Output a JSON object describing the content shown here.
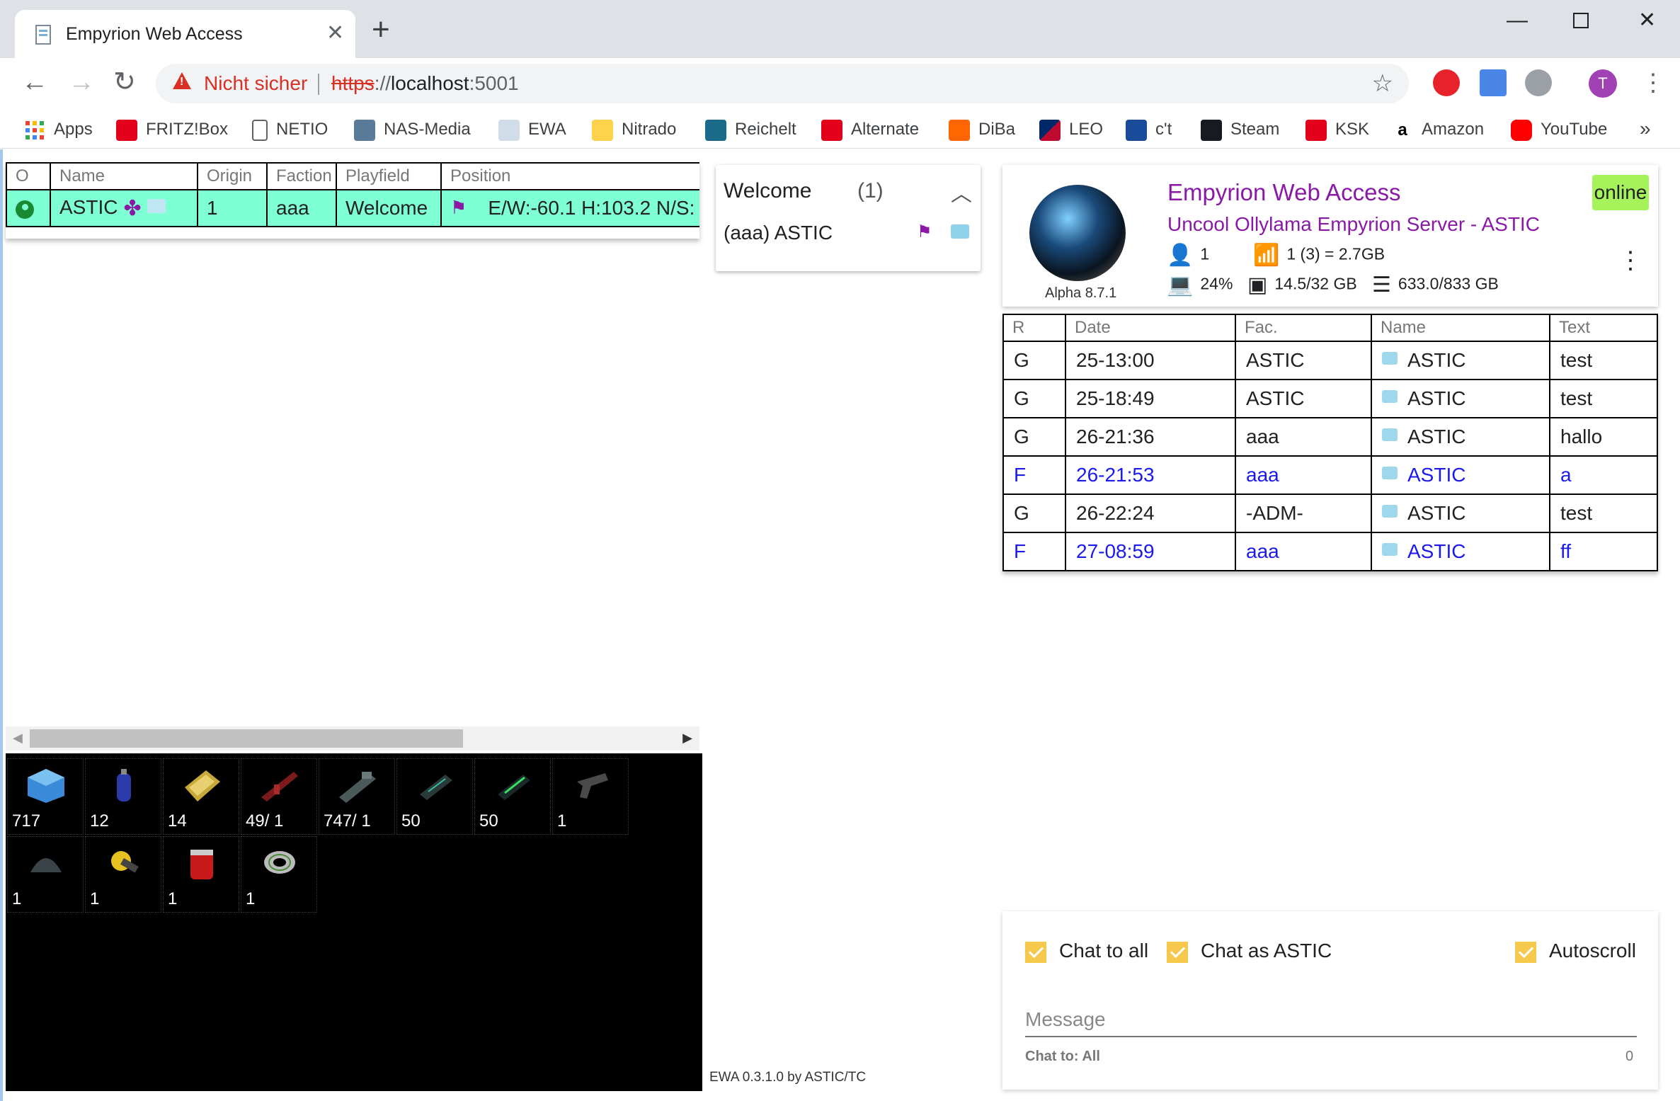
{
  "browser": {
    "tab_title": "Empyrion Web Access",
    "tab_close": "✕",
    "new_tab": "+",
    "security_label": "Nicht sicher",
    "url_scheme": "https",
    "url_sep": "://",
    "url_host": "localhost",
    "url_port": ":5001",
    "profile_initial": "T",
    "bookmarks": [
      "Apps",
      "FRITZ!Box",
      "NETIO",
      "NAS-Media",
      "EWA",
      "Nitrado",
      "Reichelt",
      "Alternate",
      "DiBa",
      "LEO",
      "c't",
      "Steam",
      "KSK",
      "Amazon",
      "YouTube"
    ],
    "bookmarks_more": "»"
  },
  "players": {
    "headers": [
      "O",
      "Name",
      "Origin",
      "Faction",
      "Playfield",
      "Position"
    ],
    "rows": [
      {
        "name": "ASTIC",
        "origin": "1",
        "faction": "aaa",
        "playfield": "Welcome",
        "position": "E/W:-60.1 H:103.2 N/S:"
      }
    ]
  },
  "inventory": [
    {
      "count": "717",
      "icon": "blue-cube-icon"
    },
    {
      "count": "12",
      "icon": "gas-canister-icon"
    },
    {
      "count": "14",
      "icon": "gold-plate-icon"
    },
    {
      "count": "49/ 1",
      "icon": "rifle-icon"
    },
    {
      "count": "747/ 1",
      "icon": "drill-icon"
    },
    {
      "count": "50",
      "icon": "ammo-box-icon"
    },
    {
      "count": "50",
      "icon": "green-ammo-icon"
    },
    {
      "count": "1",
      "icon": "pistol-icon"
    },
    {
      "count": "1",
      "icon": "helmet-icon"
    },
    {
      "count": "1",
      "icon": "flashlight-icon"
    },
    {
      "count": "1",
      "icon": "medkit-icon"
    },
    {
      "count": "1",
      "icon": "tape-icon"
    }
  ],
  "playfield_card": {
    "name": "Welcome",
    "count": "(1)",
    "player": "(aaa) ASTIC"
  },
  "footer": "EWA 0.3.1.0 by ASTIC/TC",
  "server": {
    "title": "Empyrion Web Access",
    "subtitle": "Uncool Ollylama Empyrion Server - ASTIC",
    "status": "online",
    "version": "Alpha 8.7.1",
    "players": "1",
    "network": "1 (3) = 2.7GB",
    "cpu": "24%",
    "ram": "14.5/32 GB",
    "disk": "633.0/833 GB"
  },
  "chat": {
    "headers": [
      "R",
      "Date",
      "Fac.",
      "Name",
      "Text"
    ],
    "rows": [
      {
        "r": "G",
        "date": "25-13:00",
        "fac": "ASTIC",
        "name": "ASTIC",
        "text": "test"
      },
      {
        "r": "G",
        "date": "25-18:49",
        "fac": "ASTIC",
        "name": "ASTIC",
        "text": "test"
      },
      {
        "r": "G",
        "date": "26-21:36",
        "fac": "aaa",
        "name": "ASTIC",
        "text": "hallo"
      },
      {
        "r": "F",
        "date": "26-21:53",
        "fac": "aaa",
        "name": "ASTIC",
        "text": "a"
      },
      {
        "r": "G",
        "date": "26-22:24",
        "fac": "-ADM-",
        "name": "ASTIC",
        "text": "test"
      },
      {
        "r": "F",
        "date": "27-08:59",
        "fac": "aaa",
        "name": "ASTIC",
        "text": "ff"
      }
    ]
  },
  "compose": {
    "chat_to_all": "Chat to all",
    "chat_as": "Chat as ASTIC",
    "autoscroll": "Autoscroll",
    "placeholder": "Message",
    "chat_to_label": "Chat to: All",
    "char_count": "0"
  },
  "colors": {
    "player_row_bg": "#7fffd4",
    "accent_purple": "#8a1aa6",
    "online_badge": "#a6f25a",
    "faction_chat": "#1a1aee",
    "checkbox": "#f6c94c"
  }
}
